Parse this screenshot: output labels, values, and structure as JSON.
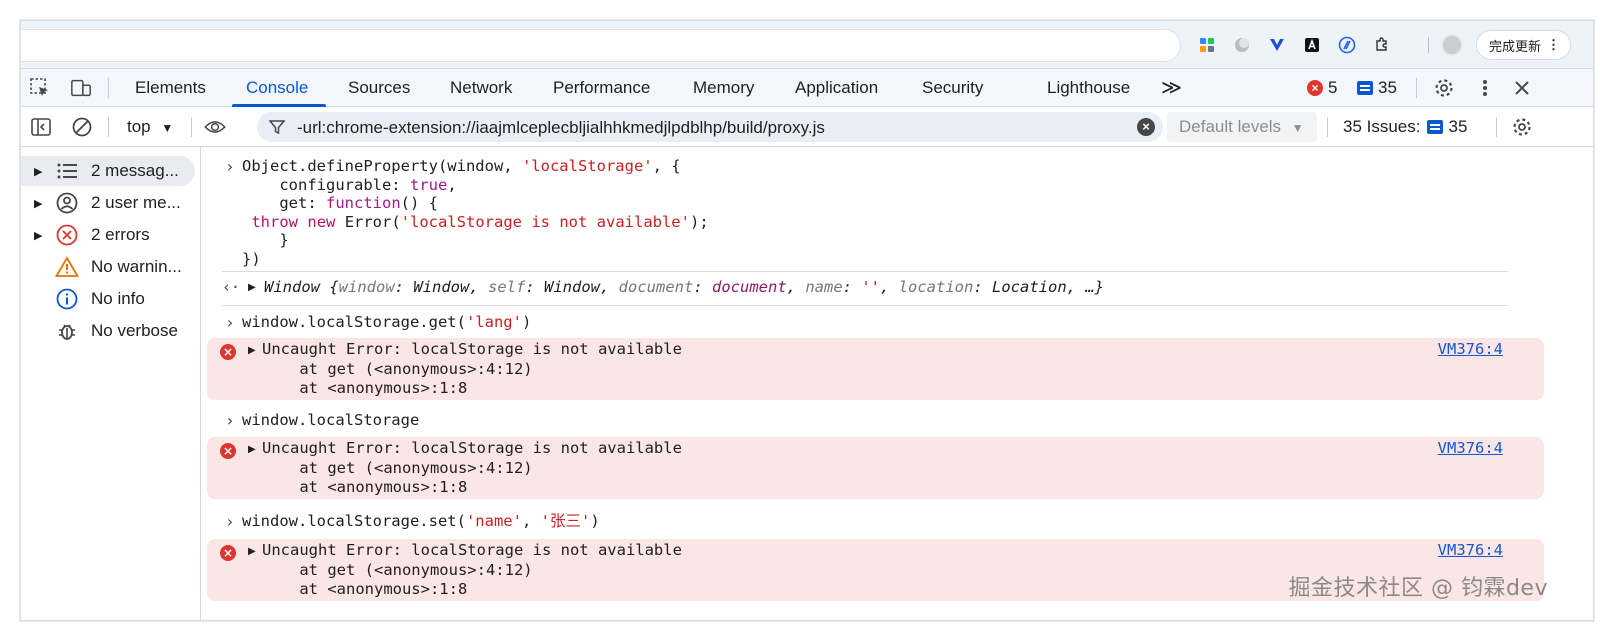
{
  "browser": {
    "update_button_label": "完成更新",
    "update_button_more": "⋮",
    "extension_icons": [
      "puzzle-grid-icon",
      "moon-icon",
      "v-logo-icon",
      "a-box-icon",
      "d-circle-icon",
      "extensions-icon"
    ]
  },
  "devtools": {
    "tabs": [
      "Elements",
      "Console",
      "Sources",
      "Network",
      "Performance",
      "Memory",
      "Application",
      "Security",
      "Lighthouse"
    ],
    "more_tabs": "≫",
    "error_count": "5",
    "message_count": "35"
  },
  "toolbar": {
    "context": "top",
    "filter_value": "-url:chrome-extension://iaajmlceplecbljialhhkmedjlpdblhp/build/proxy.js",
    "levels_label": "Default levels",
    "issues_label": "35 Issues:",
    "issues_count": "35"
  },
  "sidebar": {
    "items": [
      {
        "label": "2 messag...",
        "icon": "list-icon",
        "expandable": true
      },
      {
        "label": "2 user me...",
        "icon": "user-icon",
        "expandable": true
      },
      {
        "label": "2 errors",
        "icon": "error-icon",
        "expandable": true
      },
      {
        "label": "No warnin...",
        "icon": "warning-icon",
        "expandable": false
      },
      {
        "label": "No info",
        "icon": "info-icon",
        "expandable": false
      },
      {
        "label": "No verbose",
        "icon": "bug-icon",
        "expandable": false
      }
    ]
  },
  "console": {
    "entry1": {
      "line1_a": "Object.defineProperty(window, ",
      "line1_str": "'localStorage'",
      "line1_b": ", {",
      "line2_a": "    configurable: ",
      "line2_kw": "true",
      "line2_b": ",",
      "line3_a": "    get: ",
      "line3_kw": "function",
      "line3_b": "() {",
      "line4_kw1": "throw",
      "line4_kw2": "new",
      "line4_a": " Error(",
      "line4_str": "'localStorage is not available'",
      "line4_b": ");",
      "line5": "    }",
      "line6": "})"
    },
    "result1": {
      "prefix": "Window {",
      "k1": "window",
      "v1": "Window",
      "k2": "self",
      "v2": "Window",
      "k3": "document",
      "v3": "document",
      "k4": "name",
      "v4": "''",
      "k5": "location",
      "v5": "Location",
      "suffix": ", …}"
    },
    "cmd2_a": "window.localStorage.get(",
    "cmd2_str": "'lang'",
    "cmd2_b": ")",
    "cmd3": "window.localStorage",
    "cmd4_a": "window.localStorage.set(",
    "cmd4_str1": "'name'",
    "cmd4_sep": ", ",
    "cmd4_str2": "'张三'",
    "cmd4_b": ")",
    "error_line1": "Uncaught Error: localStorage is not available",
    "error_line2": "    at get (<anonymous>:4:12)",
    "error_line3": "    at <anonymous>:1:8",
    "error_link": "VM376:4"
  },
  "watermark": "掘金技术社区 @ 钧霖dev"
}
